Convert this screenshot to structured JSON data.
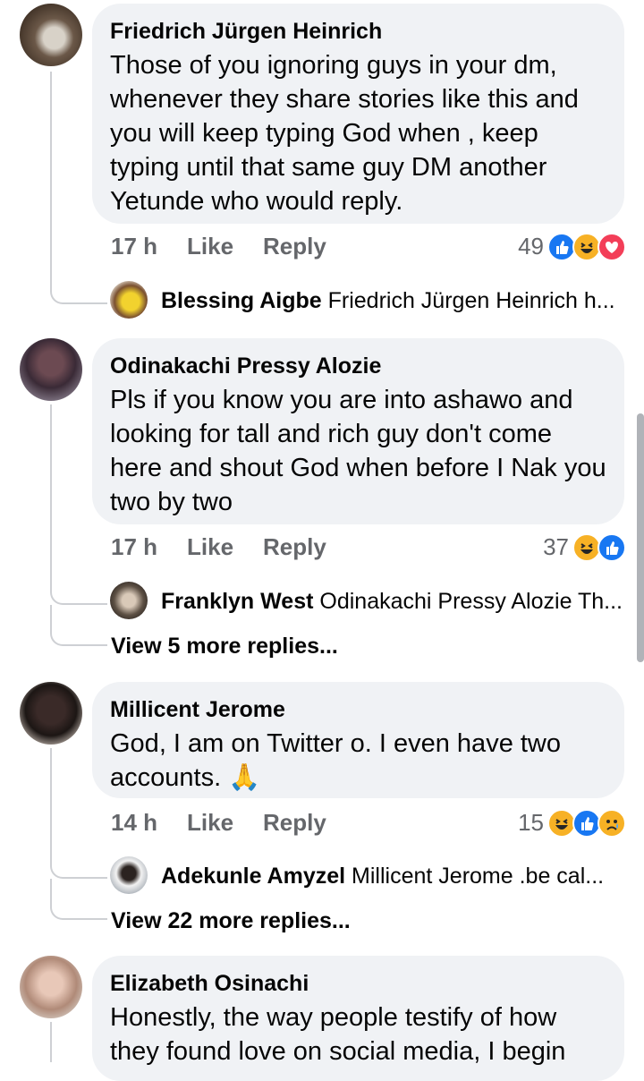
{
  "comments": [
    {
      "author": "Friedrich Jürgen Heinrich",
      "text": "Those of you ignoring guys in your dm, whenever they share stories like this and you will keep typing God when , keep typing until that same guy DM another Yetunde who would reply.",
      "time": "17 h",
      "like_label": "Like",
      "reply_label": "Reply",
      "reaction_count": "49",
      "reactions": [
        "like-icon",
        "haha-icon",
        "love-icon"
      ],
      "reply": {
        "author": "Blessing Aigbe",
        "snippet": "Friedrich Jürgen Heinrich h..."
      }
    },
    {
      "author": "Odinakachi Pressy Alozie",
      "text": "Pls if you know you are into ashawo and looking for tall and rich guy don't come here and shout God when before I Nak you two by two",
      "time": "17 h",
      "like_label": "Like",
      "reply_label": "Reply",
      "reaction_count": "37",
      "reactions": [
        "haha-icon",
        "like-icon"
      ],
      "reply": {
        "author": "Franklyn West",
        "snippet": "Odinakachi Pressy Alozie Th..."
      },
      "more_replies": "View 5 more replies..."
    },
    {
      "author": "Millicent Jerome",
      "text": "God, I am on Twitter o. I even have two accounts. 🙏",
      "time": "14 h",
      "like_label": "Like",
      "reply_label": "Reply",
      "reaction_count": "15",
      "reactions": [
        "haha-icon",
        "like-icon",
        "sad-icon"
      ],
      "reply": {
        "author": "Adekunle Amyzel",
        "snippet": "Millicent Jerome .be cal..."
      },
      "more_replies": "View 22 more replies..."
    },
    {
      "author": "Elizabeth Osinachi",
      "text": "Honestly, the way people testify of how they found love on social media, I begin"
    }
  ],
  "colors": {
    "bubble": "#f0f2f5",
    "meta_text": "#65676b",
    "like_blue": "#1877f2",
    "haha_yellow": "#f7b125",
    "love_red": "#f33e58"
  }
}
